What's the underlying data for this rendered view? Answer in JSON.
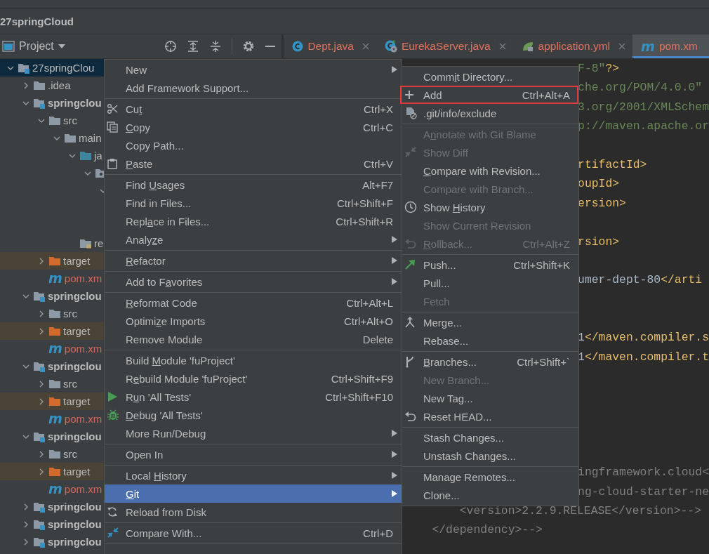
{
  "project_title": "27springCloud",
  "tool_window": {
    "label": "Project"
  },
  "tabs": [
    {
      "label": "Dept.java",
      "kind": "class",
      "selected": false
    },
    {
      "label": "EurekaServer.java",
      "kind": "spring",
      "selected": false
    },
    {
      "label": "application.yml",
      "kind": "leaf",
      "selected": false
    },
    {
      "label": "pom.xm",
      "kind": "maven",
      "icon_text": "m",
      "selected": true
    }
  ],
  "tree": [
    {
      "label": "27springClou",
      "kind": "module",
      "bold": false,
      "expanded": true,
      "selected": true,
      "children": [
        {
          "label": ".idea",
          "kind": "folder",
          "bold": false,
          "expanded": false,
          "selected": false
        },
        {
          "label": "springclou",
          "kind": "module",
          "bold": true,
          "expanded": true,
          "selected": false,
          "children": [
            {
              "label": "src",
              "kind": "folder",
              "bold": false,
              "expanded": true,
              "selected": false,
              "children": [
                {
                  "label": "main",
                  "kind": "folder",
                  "bold": false,
                  "expanded": true,
                  "selected": false,
                  "children": [
                    {
                      "label": "ja",
                      "kind": "source",
                      "bold": false,
                      "expanded": true,
                      "selected": false,
                      "children": [
                        {
                          "kind": "package",
                          "expanded": true,
                          "children": [
                            {
                              "expanded": true,
                              "selected": false,
                              "children": [
                                {
                                  "selected": false
                                },
                                {
                                  "selected": false
                                }
                              ]
                            }
                          ]
                        }
                      ]
                    },
                    {
                      "label": "re",
                      "kind": "resources",
                      "bold": false,
                      "selected": false
                    }
                  ]
                }
              ]
            },
            {
              "label": "target",
              "kind": "excluded",
              "bold": false,
              "expanded": false,
              "selected": false
            },
            {
              "label": "pom.xm",
              "kind": "maven",
              "icon_text": "m",
              "bold": false,
              "selected": false
            }
          ]
        },
        {
          "label": "springclou",
          "kind": "module",
          "bold": true,
          "expanded": true,
          "selected": false,
          "children": [
            {
              "label": "src",
              "kind": "folder",
              "bold": false,
              "expanded": false,
              "selected": false
            },
            {
              "label": "target",
              "kind": "excluded",
              "bold": false,
              "expanded": false,
              "selected": false
            },
            {
              "label": "pom.xm",
              "kind": "maven",
              "icon_text": "m",
              "bold": false,
              "selected": false
            }
          ]
        },
        {
          "label": "springclou",
          "kind": "module",
          "bold": true,
          "expanded": true,
          "selected": false,
          "children": [
            {
              "label": "src",
              "kind": "folder",
              "bold": false,
              "expanded": false,
              "selected": false
            },
            {
              "label": "target",
              "kind": "excluded",
              "bold": false,
              "expanded": false,
              "selected": false
            },
            {
              "label": "pom.xm",
              "kind": "maven",
              "icon_text": "m",
              "bold": false,
              "selected": false
            }
          ]
        },
        {
          "label": "springclou",
          "kind": "module",
          "bold": true,
          "expanded": true,
          "selected": false,
          "children": [
            {
              "label": "src",
              "kind": "folder",
              "bold": false,
              "expanded": false,
              "selected": false
            },
            {
              "label": "target",
              "kind": "excluded",
              "bold": false,
              "expanded": false,
              "selected": false
            },
            {
              "label": "pom.xm",
              "kind": "maven",
              "icon_text": "m",
              "bold": false,
              "selected": false
            }
          ]
        },
        {
          "label": "springclou",
          "kind": "module",
          "bold": true,
          "expanded": false,
          "selected": false
        },
        {
          "label": "springclou",
          "kind": "module",
          "bold": true,
          "expanded": false,
          "selected": false
        },
        {
          "label": "springclou",
          "kind": "module",
          "bold": true,
          "expanded": false,
          "selected": false
        }
      ]
    }
  ],
  "code_lines": [
    {
      "kind": "clipped",
      "segments": [
        {
          "text": "F-8\"",
          "kind": "string"
        },
        {
          "text": "?>",
          "kind": "tag"
        }
      ]
    },
    {
      "kind": "clipped",
      "segments": [
        {
          "text": "che.org/POM/4.0.0\"",
          "kind": "string"
        }
      ]
    },
    {
      "kind": "clipped",
      "segments": [
        {
          "text": "3.org/2001/XMLSchem",
          "kind": "string"
        }
      ]
    },
    {
      "kind": "clipped",
      "segments": [
        {
          "text": "p://maven.apache.or",
          "kind": "string"
        }
      ]
    },
    {
      "kind": "blank"
    },
    {
      "kind": "clipped",
      "segments": [
        {
          "text": "rtifactId>",
          "kind": "tag"
        }
      ]
    },
    {
      "kind": "clipped",
      "segments": [
        {
          "text": "oupId>",
          "kind": "tag"
        }
      ]
    },
    {
      "kind": "clipped",
      "segments": [
        {
          "text": "ersion>",
          "kind": "tag"
        }
      ]
    },
    {
      "kind": "blank"
    },
    {
      "kind": "clipped",
      "segments": [
        {
          "text": "rsion>",
          "kind": "tag"
        }
      ]
    },
    {
      "kind": "blank"
    },
    {
      "kind": "clipped",
      "segments": [
        {
          "text": "umer-dept-80",
          "kind": "text"
        },
        {
          "text": "</arti",
          "kind": "tag"
        }
      ]
    },
    {
      "kind": "blank"
    },
    {
      "kind": "blank"
    },
    {
      "kind": "clipped",
      "segments": [
        {
          "text": "1",
          "kind": "text"
        },
        {
          "text": "</maven.compiler.s",
          "kind": "tag"
        }
      ]
    },
    {
      "kind": "clipped",
      "segments": [
        {
          "text": "1",
          "kind": "text"
        },
        {
          "text": "</maven.compiler.t",
          "kind": "tag"
        }
      ]
    },
    {
      "kind": "blank"
    },
    {
      "kind": "blank"
    },
    {
      "kind": "blank"
    },
    {
      "kind": "blank"
    },
    {
      "kind": "blank"
    },
    {
      "kind": "clipped",
      "segments": [
        {
          "text": "ingframework.cloud<",
          "kind": "comment"
        }
      ]
    },
    {
      "kind": "clipped",
      "segments": [
        {
          "text": "ng-cloud-starter-ne",
          "kind": "comment"
        }
      ]
    },
    {
      "kind": "full",
      "segments": [
        {
          "text": "        <version>2.2.9.RELEASE</version>-->",
          "kind": "comment"
        }
      ]
    },
    {
      "kind": "full",
      "segments": [
        {
          "text": "    </dependency>-->",
          "kind": "comment"
        }
      ]
    }
  ],
  "context_menu": {
    "items": [
      {
        "kind": "item",
        "label": "New",
        "submenu": true,
        "selected": false,
        "disabled": false
      },
      {
        "kind": "item",
        "label": "Add Framework Support...",
        "selected": false,
        "disabled": false
      },
      {
        "kind": "separator"
      },
      {
        "kind": "scissors",
        "label": "Cu",
        "mnemonic": "t",
        "shortcut": "Ctrl+X",
        "selected": false,
        "disabled": false
      },
      {
        "kind": "copy",
        "mnemonic": "C",
        "label_rest": "opy",
        "shortcut": "Ctrl+C",
        "selected": false,
        "disabled": false
      },
      {
        "kind": "item",
        "label": "Copy Path...",
        "selected": false,
        "disabled": false
      },
      {
        "kind": "clipboard",
        "mnemonic": "P",
        "label_rest": "aste",
        "shortcut": "Ctrl+V",
        "selected": false,
        "disabled": false
      },
      {
        "kind": "separator"
      },
      {
        "kind": "item",
        "label": "Find ",
        "mnemonic": "U",
        "label_rest": "sages",
        "shortcut": "Alt+F7",
        "selected": false,
        "disabled": false
      },
      {
        "kind": "item",
        "label": "Find in Files...",
        "shortcut": "Ctrl+Shift+F",
        "selected": false,
        "disabled": false
      },
      {
        "kind": "item",
        "label": "Repl",
        "mnemonic": "a",
        "label_rest": "ce in Files...",
        "shortcut": "Ctrl+Shift+R",
        "selected": false,
        "disabled": false
      },
      {
        "kind": "item",
        "label": "Analy",
        "mnemonic": "z",
        "label_rest": "e",
        "submenu": true,
        "selected": false,
        "disabled": false
      },
      {
        "kind": "separator"
      },
      {
        "kind": "item",
        "mnemonic": "R",
        "label_rest": "efactor",
        "submenu": true,
        "selected": false,
        "disabled": false
      },
      {
        "kind": "separator"
      },
      {
        "kind": "item",
        "label": "Add to F",
        "mnemonic": "a",
        "label_rest": "vorites",
        "submenu": true,
        "selected": false,
        "disabled": false
      },
      {
        "kind": "separator"
      },
      {
        "kind": "item",
        "mnemonic": "R",
        "label_rest": "eformat Code",
        "shortcut": "Ctrl+Alt+L",
        "selected": false,
        "disabled": false
      },
      {
        "kind": "item",
        "label": "Optimi",
        "mnemonic": "z",
        "label_rest": "e Imports",
        "shortcut": "Ctrl+Alt+O",
        "selected": false,
        "disabled": false
      },
      {
        "kind": "item",
        "label": "Remove Module",
        "shortcut": "Delete",
        "selected": false,
        "disabled": false
      },
      {
        "kind": "separator"
      },
      {
        "kind": "item",
        "label": "Build ",
        "mnemonic": "M",
        "label_rest": "odule 'fuProject'",
        "selected": false,
        "disabled": false
      },
      {
        "kind": "item",
        "label": "R",
        "mnemonic": "e",
        "label_rest": "build Module 'fuProject'",
        "shortcut": "Ctrl+Shift+F9",
        "selected": false,
        "disabled": false
      },
      {
        "kind": "play",
        "label": "R",
        "mnemonic": "u",
        "label_rest": "n 'All Tests'",
        "shortcut": "Ctrl+Shift+F10",
        "selected": false,
        "disabled": false
      },
      {
        "kind": "bug",
        "mnemonic": "D",
        "label_rest": "ebug 'All Tests'",
        "selected": false,
        "disabled": false
      },
      {
        "kind": "item",
        "label": "More Run/Debug",
        "submenu": true,
        "selected": false,
        "disabled": false
      },
      {
        "kind": "separator"
      },
      {
        "kind": "item",
        "label": "Open In",
        "submenu": true,
        "selected": false,
        "disabled": false
      },
      {
        "kind": "separator"
      },
      {
        "kind": "item",
        "label": "Local ",
        "mnemonic": "H",
        "label_rest": "istory",
        "submenu": true,
        "selected": false,
        "disabled": false
      },
      {
        "kind": "item",
        "mnemonic": "G",
        "label_rest": "it",
        "submenu": true,
        "selected": true,
        "disabled": false
      },
      {
        "kind": "reload",
        "label": "Reload from Disk",
        "selected": false,
        "disabled": false
      },
      {
        "kind": "separator"
      },
      {
        "kind": "compare",
        "label": "Compare With...",
        "shortcut": "Ctrl+D",
        "selected": false,
        "disabled": false
      },
      {
        "kind": "separator"
      }
    ]
  },
  "git_submenu": {
    "items": [
      {
        "kind": "item",
        "label": "Comm",
        "mnemonic": "i",
        "label_rest": "t Directory...",
        "selected": false,
        "disabled": false,
        "outlined": false
      },
      {
        "kind": "plus",
        "label": "Add",
        "shortcut": "Ctrl+Alt+A",
        "selected": false,
        "disabled": false,
        "outlined": true
      },
      {
        "kind": "exclude",
        "label": ".git/info/exclude",
        "selected": false,
        "disabled": false,
        "outlined": false
      },
      {
        "kind": "separator"
      },
      {
        "kind": "item",
        "label": "A",
        "mnemonic": "n",
        "label_rest": "notate with Git Blame",
        "selected": false,
        "disabled": true,
        "outlined": false
      },
      {
        "kind": "compare",
        "label": "Show Diff",
        "selected": false,
        "disabled": true,
        "outlined": false
      },
      {
        "kind": "item",
        "mnemonic": "C",
        "label_rest": "ompare with Revision...",
        "selected": false,
        "disabled": false,
        "outlined": false
      },
      {
        "kind": "item",
        "label": "Compare with Branch...",
        "selected": false,
        "disabled": true,
        "outlined": false
      },
      {
        "kind": "clock",
        "label": "Show ",
        "mnemonic": "H",
        "label_rest": "istory",
        "selected": false,
        "disabled": false,
        "outlined": false
      },
      {
        "kind": "item",
        "label": "Show Current Revision",
        "selected": false,
        "disabled": true,
        "outlined": false
      },
      {
        "kind": "undo",
        "mnemonic": "R",
        "label_rest": "ollback...",
        "shortcut": "Ctrl+Alt+Z",
        "selected": false,
        "disabled": true,
        "outlined": false
      },
      {
        "kind": "separator"
      },
      {
        "kind": "push",
        "label": "Push...",
        "shortcut": "Ctrl+Shift+K",
        "selected": false,
        "disabled": false,
        "outlined": false
      },
      {
        "kind": "item",
        "label": "Pull...",
        "selected": false,
        "disabled": false,
        "outlined": false
      },
      {
        "kind": "item",
        "label": "Fetch",
        "selected": false,
        "disabled": true,
        "outlined": false
      },
      {
        "kind": "separator"
      },
      {
        "kind": "merge",
        "label": "Merge...",
        "selected": false,
        "disabled": false,
        "outlined": false
      },
      {
        "kind": "item",
        "label": "Rebase...",
        "selected": false,
        "disabled": false,
        "outlined": false
      },
      {
        "kind": "separator"
      },
      {
        "kind": "branch",
        "mnemonic": "B",
        "label_rest": "ranches...",
        "shortcut": "Ctrl+Shift+`",
        "selected": false,
        "disabled": false,
        "outlined": false
      },
      {
        "kind": "item",
        "label": "New Branch...",
        "selected": false,
        "disabled": true,
        "outlined": false
      },
      {
        "kind": "item",
        "label": "New Tag...",
        "selected": false,
        "disabled": false,
        "outlined": false
      },
      {
        "kind": "undo",
        "label": "Reset HEAD...",
        "selected": false,
        "disabled": false,
        "outlined": false
      },
      {
        "kind": "separator"
      },
      {
        "kind": "item",
        "label": "Stash Changes...",
        "selected": false,
        "disabled": false,
        "outlined": false
      },
      {
        "kind": "item",
        "label": "Unstash Changes...",
        "selected": false,
        "disabled": false,
        "outlined": false
      },
      {
        "kind": "separator"
      },
      {
        "kind": "item",
        "label": "Manage Remotes...",
        "selected": false,
        "disabled": false,
        "outlined": false
      },
      {
        "kind": "item",
        "label": "Clone...",
        "selected": false,
        "disabled": false,
        "outlined": false
      }
    ]
  }
}
